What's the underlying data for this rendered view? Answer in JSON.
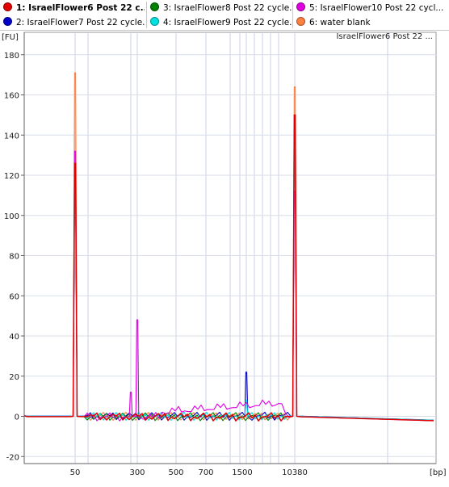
{
  "legend": {
    "items": [
      {
        "label": "1: IsraelFlower6 Post 22 c...",
        "color": "#e00000",
        "selected": true
      },
      {
        "label": "2: IsraelFlower7 Post 22 cycle...",
        "color": "#0000c8",
        "selected": false
      },
      {
        "label": "3: IsraelFlower8 Post 22 cycle...",
        "color": "#008000",
        "selected": false
      },
      {
        "label": "4: IsraelFlower9 Post 22 cycle...",
        "color": "#00e0e0",
        "selected": false
      },
      {
        "label": "5: IsraelFlower10 Post 22 cycl...",
        "color": "#e000e0",
        "selected": false
      },
      {
        "label": "6: water blank",
        "color": "#ff8040",
        "selected": false
      }
    ]
  },
  "sample_label": "IsraelFlower6 Post 22 ...",
  "chart_data": {
    "type": "line",
    "y_unit": "[FU]",
    "x_unit": "[bp]",
    "ylim": [
      -22,
      182
    ],
    "y_ticks": [
      -20,
      0,
      20,
      40,
      60,
      80,
      100,
      120,
      140,
      160,
      180
    ],
    "x_tick_labels": [
      "50",
      "300",
      "500",
      "700",
      "1500",
      "10380"
    ],
    "grid": true,
    "series": [
      {
        "name": "1: IsraelFlower6 Post 22 c...",
        "color": "#e00000",
        "peaks": [
          {
            "x": "35",
            "y": 126
          },
          {
            "x": "10380",
            "y": 150
          }
        ],
        "baseline": 0
      },
      {
        "name": "2: IsraelFlower7 Post 22 cycle...",
        "color": "#0000c8",
        "peaks": [
          {
            "x": "35",
            "y": 120
          },
          {
            "x": "1500",
            "y": 22
          },
          {
            "x": "10380",
            "y": 140
          }
        ],
        "baseline": 0
      },
      {
        "name": "3: IsraelFlower8 Post 22 cycle...",
        "color": "#008000",
        "peaks": [
          {
            "x": "35",
            "y": 118
          },
          {
            "x": "10380",
            "y": 138
          }
        ],
        "baseline": 0
      },
      {
        "name": "4: IsraelFlower9 Post 22 cycle...",
        "color": "#00e0e0",
        "peaks": [
          {
            "x": "35",
            "y": 115
          },
          {
            "x": "1500",
            "y": 8
          },
          {
            "x": "10380",
            "y": 135
          }
        ],
        "baseline": 0
      },
      {
        "name": "5: IsraelFlower10 Post 22 cycl...",
        "color": "#e000e0",
        "peaks": [
          {
            "x": "35",
            "y": 132
          },
          {
            "x": "300",
            "y": 48
          },
          {
            "x": "250",
            "y": 12
          },
          {
            "x": "10380",
            "y": 112
          }
        ],
        "baseline": 0
      },
      {
        "name": "6: water blank",
        "color": "#ff8040",
        "peaks": [
          {
            "x": "35",
            "y": 171
          },
          {
            "x": "10380",
            "y": 164
          }
        ],
        "baseline": 0
      }
    ]
  }
}
